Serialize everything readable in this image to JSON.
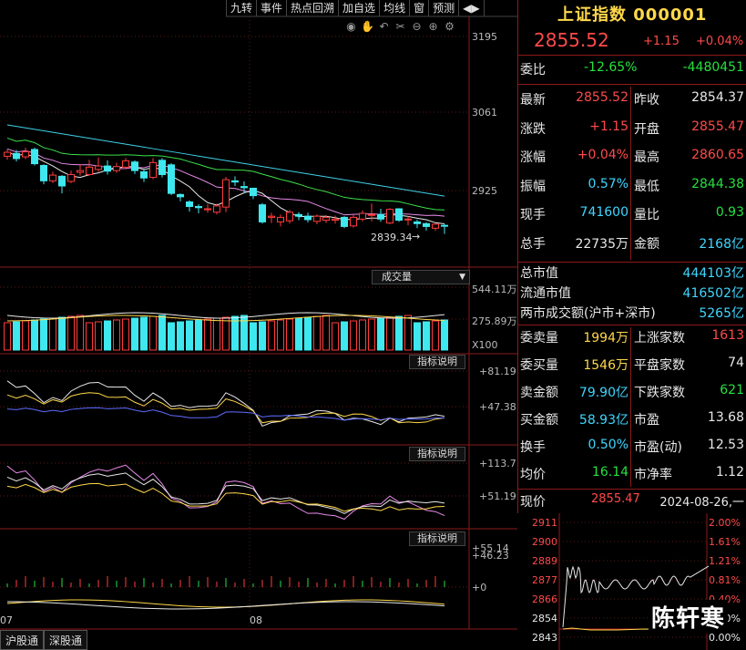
{
  "toolbar": {
    "items": [
      "九转",
      "事件",
      "热点回溯",
      "加自选",
      "均线",
      "窗",
      "预测",
      "◀▶"
    ]
  },
  "tool_icons": [
    "eye-icon",
    "hand-icon",
    "undo-icon",
    "scissors-icon",
    "zoom-out-icon",
    "zoom-in-icon",
    "settings-icon"
  ],
  "kline": {
    "axis": [
      "3195",
      "3061",
      "2925"
    ],
    "low_label": "2839.34",
    "ma_colors": {
      "ma_long": "#3fd0e8",
      "ma_mid": "#3ce04a",
      "ma_short": "#e8e8e8",
      "ma_pink": "#e88ae8"
    },
    "candles": [
      {
        "o": 2985,
        "c": 2992,
        "h": 2997,
        "l": 2979
      },
      {
        "o": 2990,
        "c": 2981,
        "h": 2996,
        "l": 2976
      },
      {
        "o": 2984,
        "c": 2993,
        "h": 3000,
        "l": 2980
      },
      {
        "o": 2997,
        "c": 2972,
        "h": 3000,
        "l": 2969
      },
      {
        "o": 2969,
        "c": 2942,
        "h": 2971,
        "l": 2936
      },
      {
        "o": 2942,
        "c": 2952,
        "h": 2958,
        "l": 2938
      },
      {
        "o": 2950,
        "c": 2933,
        "h": 2952,
        "l": 2920
      },
      {
        "o": 2941,
        "c": 2953,
        "h": 2960,
        "l": 2938
      },
      {
        "o": 2957,
        "c": 2960,
        "h": 2971,
        "l": 2951
      },
      {
        "o": 2953,
        "c": 2966,
        "h": 2979,
        "l": 2951
      },
      {
        "o": 2962,
        "c": 2968,
        "h": 2983,
        "l": 2958
      },
      {
        "o": 2968,
        "c": 2959,
        "h": 2978,
        "l": 2953
      },
      {
        "o": 2960,
        "c": 2967,
        "h": 2974,
        "l": 2956
      },
      {
        "o": 2966,
        "c": 2977,
        "h": 2982,
        "l": 2962
      },
      {
        "o": 2975,
        "c": 2960,
        "h": 2978,
        "l": 2954
      },
      {
        "o": 2958,
        "c": 2947,
        "h": 2963,
        "l": 2940
      },
      {
        "o": 2948,
        "c": 2974,
        "h": 2982,
        "l": 2945
      },
      {
        "o": 2978,
        "c": 2953,
        "h": 2982,
        "l": 2948
      },
      {
        "o": 2970,
        "c": 2920,
        "h": 2973,
        "l": 2917
      },
      {
        "o": 2918,
        "c": 2914,
        "h": 2920,
        "l": 2906
      },
      {
        "o": 2905,
        "c": 2897,
        "h": 2908,
        "l": 2888
      },
      {
        "o": 2897,
        "c": 2895,
        "h": 2901,
        "l": 2885
      },
      {
        "o": 2892,
        "c": 2893,
        "h": 2901,
        "l": 2886
      },
      {
        "o": 2887,
        "c": 2898,
        "h": 2902,
        "l": 2883
      },
      {
        "o": 2896,
        "c": 2944,
        "h": 2949,
        "l": 2887
      },
      {
        "o": 2942,
        "c": 2940,
        "h": 2950,
        "l": 2933
      },
      {
        "o": 2932,
        "c": 2930,
        "h": 2941,
        "l": 2920
      },
      {
        "o": 2929,
        "c": 2916,
        "h": 2930,
        "l": 2910
      },
      {
        "o": 2900,
        "c": 2870,
        "h": 2903,
        "l": 2867
      },
      {
        "o": 2878,
        "c": 2880,
        "h": 2886,
        "l": 2868
      },
      {
        "o": 2870,
        "c": 2878,
        "h": 2883,
        "l": 2862
      },
      {
        "o": 2872,
        "c": 2887,
        "h": 2891,
        "l": 2867
      },
      {
        "o": 2883,
        "c": 2880,
        "h": 2887,
        "l": 2873
      },
      {
        "o": 2880,
        "c": 2874,
        "h": 2886,
        "l": 2869
      },
      {
        "o": 2871,
        "c": 2880,
        "h": 2883,
        "l": 2866
      },
      {
        "o": 2873,
        "c": 2878,
        "h": 2882,
        "l": 2868
      },
      {
        "o": 2873,
        "c": 2875,
        "h": 2881,
        "l": 2867
      },
      {
        "o": 2878,
        "c": 2862,
        "h": 2880,
        "l": 2859
      },
      {
        "o": 2863,
        "c": 2878,
        "h": 2882,
        "l": 2860
      },
      {
        "o": 2875,
        "c": 2885,
        "h": 2890,
        "l": 2871
      },
      {
        "o": 2883,
        "c": 2883,
        "h": 2902,
        "l": 2871
      },
      {
        "o": 2883,
        "c": 2875,
        "h": 2893,
        "l": 2870
      },
      {
        "o": 2868,
        "c": 2892,
        "h": 2894,
        "l": 2866
      },
      {
        "o": 2893,
        "c": 2873,
        "h": 2894,
        "l": 2870
      },
      {
        "o": 2875,
        "c": 2875,
        "h": 2880,
        "l": 2864
      },
      {
        "o": 2870,
        "c": 2867,
        "h": 2874,
        "l": 2859
      },
      {
        "o": 2867,
        "c": 2862,
        "h": 2869,
        "l": 2855
      },
      {
        "o": 2859,
        "c": 2866,
        "h": 2868,
        "l": 2855
      },
      {
        "o": 2864,
        "c": 2863,
        "h": 2866,
        "l": 2849
      }
    ]
  },
  "volume": {
    "label": "成交量",
    "axis": [
      "544.11万",
      "275.89万",
      "X100"
    ]
  },
  "ind1": {
    "label": "指标说明",
    "axis": [
      "+81.19",
      "+47.38"
    ]
  },
  "ind2": {
    "label": "指标说明",
    "axis": [
      "+113.7",
      "+51.19"
    ]
  },
  "ind3": {
    "label": "指标说明",
    "axis": [
      "+55.14",
      "+46.23",
      "+0"
    ]
  },
  "dates": [
    "07",
    "08"
  ],
  "quote": {
    "title": "上证指数 000001",
    "price": "2855.52",
    "change": "+1.15",
    "pct": "+0.04%",
    "weibi_label": "委比",
    "weibi_pct": "-12.65%",
    "weibi_val": "-4480451",
    "rows": [
      {
        "l1": "最新",
        "v1": "2855.52",
        "c1": "red",
        "l2": "昨收",
        "v2": "2854.37",
        "c2": "white"
      },
      {
        "l1": "涨跌",
        "v1": "+1.15",
        "c1": "red",
        "l2": "开盘",
        "v2": "2855.47",
        "c2": "red"
      },
      {
        "l1": "涨幅",
        "v1": "+0.04%",
        "c1": "red",
        "l2": "最高",
        "v2": "2860.65",
        "c2": "red"
      },
      {
        "l1": "振幅",
        "v1": "0.57%",
        "c1": "cyan",
        "l2": "最低",
        "v2": "2844.38",
        "c2": "green"
      },
      {
        "l1": "现手",
        "v1": "741600",
        "c1": "cyan",
        "l2": "量比",
        "v2": "0.93",
        "c2": "green"
      },
      {
        "l1": "总手",
        "v1": "22735万",
        "c1": "white",
        "l2": "金额",
        "v2": "2168亿",
        "c2": "cyan"
      }
    ],
    "mkt": [
      {
        "l": "总市值",
        "v": "444103亿"
      },
      {
        "l": "流通市值",
        "v": "416502亿"
      },
      {
        "l": "两市成交额(沪市+深市)",
        "v": "5265亿"
      }
    ],
    "rows2": [
      {
        "l1": "委卖量",
        "v1": "1994万",
        "c1": "yellow",
        "l2": "上涨家数",
        "v2": "1613",
        "c2": "red"
      },
      {
        "l1": "委买量",
        "v1": "1546万",
        "c1": "yellow",
        "l2": "平盘家数",
        "v2": "74",
        "c2": "white"
      },
      {
        "l1": "卖金额",
        "v1": "79.90亿",
        "c1": "cyan",
        "l2": "下跌家数",
        "v2": "621",
        "c2": "green"
      },
      {
        "l1": "买金额",
        "v1": "58.93亿",
        "c1": "cyan",
        "l2": "市盈",
        "v2": "13.68",
        "c2": "white"
      },
      {
        "l1": "换手",
        "v1": "0.50%",
        "c1": "cyan",
        "l2": "市盈(动)",
        "v2": "12.53",
        "c2": "white"
      },
      {
        "l1": "均价",
        "v1": "16.14",
        "c1": "green",
        "l2": "市净率",
        "v2": "1.12",
        "c2": "white"
      }
    ],
    "current_label": "现价",
    "current_val": "2855.47",
    "date": "2024-08-26,一"
  },
  "mini": {
    "left_axis": [
      "2911",
      "2900",
      "2889",
      "2877",
      "2866",
      "2854",
      "2843"
    ],
    "right_axis": [
      "2.00%",
      "1.61%",
      "1.21%",
      "0.81%",
      "0.40%",
      "0.00%",
      "0.00%"
    ]
  },
  "watermark": "陈轩寒",
  "tabs": [
    "沪股通",
    "深股通"
  ]
}
